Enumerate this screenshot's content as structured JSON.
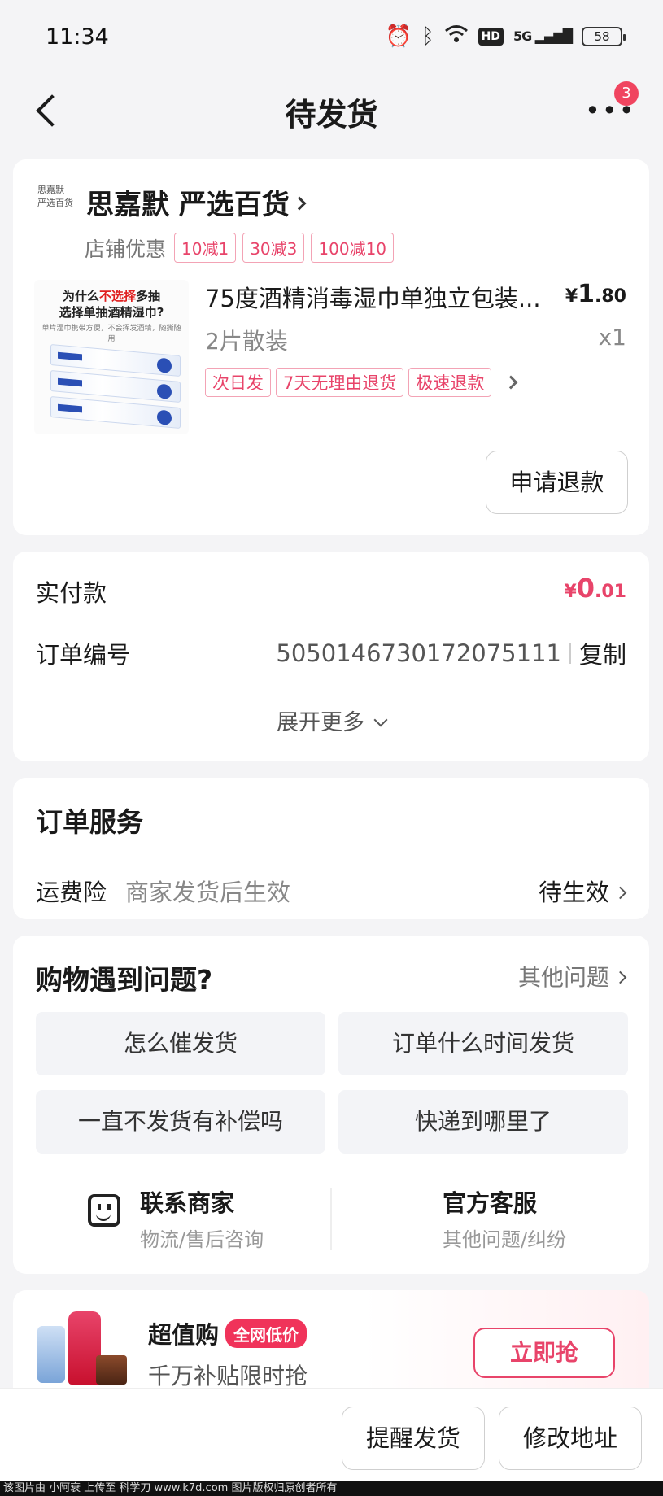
{
  "status_bar": {
    "time": "11:34",
    "icons": [
      "alarm-icon",
      "bluetooth-icon",
      "wifi-icon",
      "hd-icon",
      "5g-signal-icon",
      "battery-icon"
    ],
    "hd": "HD",
    "network": "5G",
    "battery": "58"
  },
  "nav": {
    "title": "待发货",
    "more_badge": "3"
  },
  "order": {
    "shop_logo_line1": "思嘉默",
    "shop_logo_line2": "严选百货",
    "shop_name": "思嘉默 严选百货",
    "promo_label": "店铺优惠",
    "coupons": [
      "10减1",
      "30减3",
      "100减10"
    ],
    "product": {
      "image_headline_a": "为什么",
      "image_headline_red": "不选择",
      "image_headline_b": "多抽",
      "image_headline_line2": "选择单抽酒精湿巾?",
      "image_sub": "单片湿巾携带方便，不会挥发酒精，随撕随用",
      "title": "75度酒精消毒湿巾单独立包装...",
      "price_symbol": "¥",
      "price_int": "1",
      "price_dec": ".80",
      "spec": "2片散装",
      "qty": "x1",
      "service_tags": [
        "次日发",
        "7天无理由退货",
        "极速退款"
      ]
    },
    "refund_button": "申请退款"
  },
  "payment": {
    "paid_label": "实付款",
    "paid_symbol": "¥",
    "paid_int": "0",
    "paid_dec": ".01",
    "order_no_label": "订单编号",
    "order_no": "5050146730172075111",
    "copy_label": "复制",
    "expand_label": "展开更多"
  },
  "service": {
    "title": "订单服务",
    "insurance_label": "运费险",
    "insurance_desc": "商家发货后生效",
    "insurance_status": "待生效"
  },
  "help": {
    "title": "购物遇到问题?",
    "other_label": "其他问题",
    "questions": [
      "怎么催发货",
      "订单什么时间发货",
      "一直不发货有补偿吗",
      "快递到哪里了"
    ],
    "contact_merchant": {
      "title": "联系商家",
      "sub": "物流/售后咨询"
    },
    "official_service": {
      "title": "官方客服",
      "sub": "其他问题/纠纷"
    }
  },
  "banner": {
    "title": "超值购",
    "tag": "全网低价",
    "subtitle": "千万补贴限时抢",
    "button": "立即抢"
  },
  "bottom_bar": {
    "remind_button": "提醒发货",
    "modify_button": "修改地址"
  },
  "watermark": "该图片由 小阿衰 上传至 科学刀 www.k7d.com 图片版权归原创者所有",
  "colors": {
    "accent": "#e8446a",
    "badge": "#f0445f",
    "background": "#f4f4f6"
  }
}
